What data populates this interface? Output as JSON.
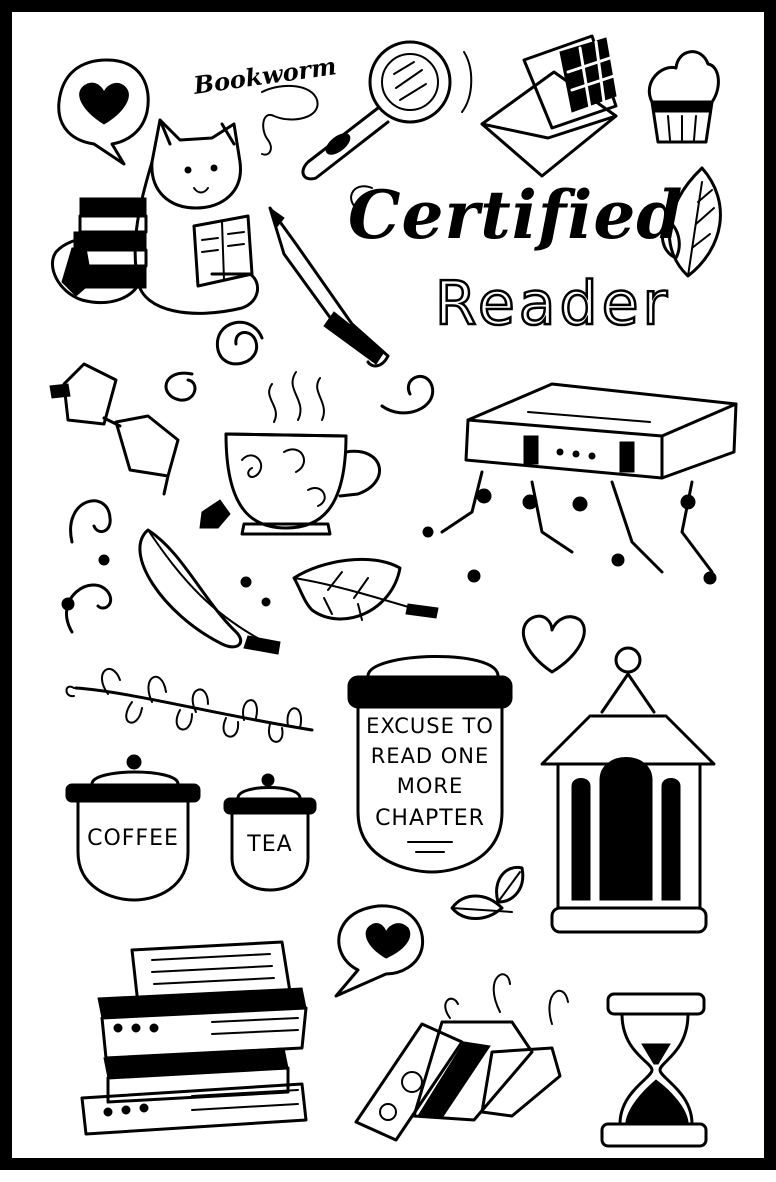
{
  "sheet": {
    "headline_script": "Certified",
    "headline_outline": "Reader",
    "sticker_bookworm": "Bookworm"
  },
  "jars": {
    "big_jar": [
      "EXCUSE TO",
      "READ ONE",
      "MORE",
      "CHAPTER"
    ],
    "coffee": "COFFEE",
    "tea": "TEA"
  },
  "colors": {
    "ink": "#000000",
    "paper": "#ffffff"
  },
  "icons": [
    "speech-bubble-heart-icon",
    "cat-reading-icon",
    "book-stack-icon",
    "magnifying-glass-icon",
    "envelope-chocolate-icon",
    "cupcake-icon",
    "fountain-pen-icon",
    "leaf-icon",
    "glasses-icon",
    "teacup-icon",
    "book-with-tassels-icon",
    "swirl-icon",
    "feather-icon",
    "heart-icon",
    "branch-icon",
    "lantern-icon",
    "bookmark-tags-icon",
    "hourglass-icon"
  ]
}
